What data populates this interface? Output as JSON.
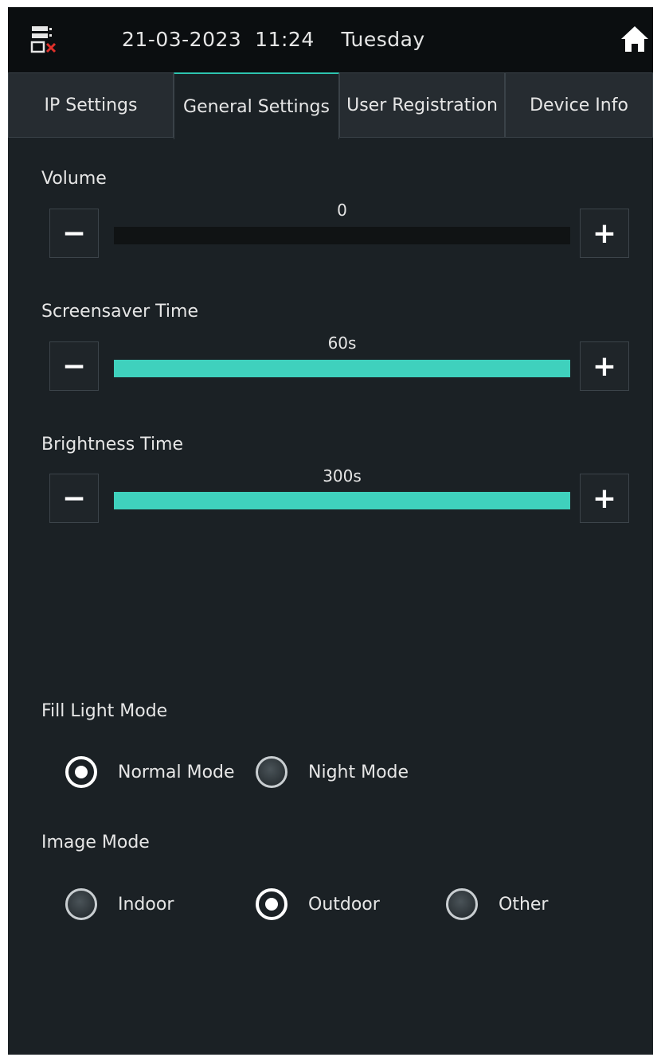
{
  "status_bar": {
    "datetime": "21-03-2023  11:24    Tuesday",
    "network_icon": "network-disconnected-icon",
    "home_icon": "home-icon"
  },
  "tabs": [
    {
      "label": "IP Settings",
      "active": false
    },
    {
      "label": "General Settings",
      "active": true
    },
    {
      "label": "User Registration",
      "active": false
    },
    {
      "label": "Device Info",
      "active": false
    }
  ],
  "sliders": {
    "volume": {
      "label": "Volume",
      "value": "0",
      "fill_fraction": 0
    },
    "screensaver": {
      "label": "Screensaver Time",
      "value": "60s",
      "fill_fraction": 1
    },
    "brightness": {
      "label": "Brightness Time",
      "value": "300s",
      "fill_fraction": 1
    },
    "minus_label": "−",
    "plus_label": "+"
  },
  "fill_light": {
    "label": "Fill Light Mode",
    "options": [
      {
        "label": "Normal Mode",
        "checked": true
      },
      {
        "label": "Night Mode",
        "checked": false
      }
    ]
  },
  "image_mode": {
    "label": "Image Mode",
    "options": [
      {
        "label": "Indoor",
        "checked": false
      },
      {
        "label": "Outdoor",
        "checked": true
      },
      {
        "label": "Other",
        "checked": false
      }
    ]
  },
  "colors": {
    "accent": "#3fd1bd",
    "background": "#1b2125",
    "status_bar": "#0b0e10",
    "error": "#e0302a"
  }
}
